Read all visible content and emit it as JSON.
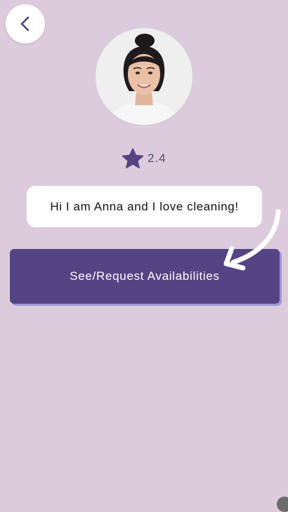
{
  "profile": {
    "rating": "2.4",
    "bio": "Hi I am Anna and I love cleaning!"
  },
  "actions": {
    "see_availabilities_label": "See/Request Availabilities"
  },
  "icons": {
    "back": "chevron-left-icon",
    "rating": "star-icon",
    "hint": "curved-arrow-icon"
  },
  "colors": {
    "background": "#dccbdc",
    "primary": "#544483",
    "primary_shadow": "#9d97d6",
    "star": "#544483"
  }
}
